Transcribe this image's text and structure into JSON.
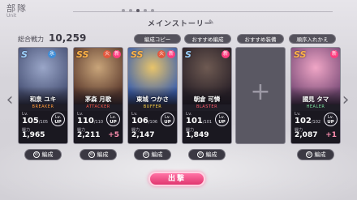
{
  "header": {
    "title": "部隊",
    "subtitle": "Unit",
    "party_name": "メインストーリー",
    "party_dots": 5,
    "active_dot": 2
  },
  "total_power": {
    "label": "総合戦力",
    "value": "10,259"
  },
  "buttons": {
    "edit_copy": "編成コピー",
    "recommend_party": "おすすめ編成",
    "recommend_equip": "おすすめ装備",
    "reorder": "順序入れかえ",
    "edit": "編成",
    "sortie": "出撃"
  },
  "lv_label": "Lv.",
  "power_label": "戦力",
  "lvup_top": "Lv.",
  "lvup_bottom": "UP",
  "members": [
    {
      "rarity": "S",
      "element": "氷",
      "element_color": "#3f8ed8",
      "new": "",
      "name": "和泉 ユキ",
      "role": "BREAKER",
      "role_color": "#ff9a3c",
      "lv": "105",
      "lv_max": "/105",
      "power": "1,965",
      "bonus": "",
      "art_a": "#9aa6c8",
      "art_b": "#4a5478"
    },
    {
      "rarity": "SS",
      "element": "火",
      "element_color": "#e2583e",
      "new": "新",
      "name": "茅森 月歌",
      "role": "ATTACKER",
      "role_color": "#ff5a4a",
      "lv": "110",
      "lv_max": "/110",
      "power": "2,211",
      "bonus": "+5",
      "art_a": "#c9a57a",
      "art_b": "#5d3b2e"
    },
    {
      "rarity": "SS",
      "element": "火",
      "element_color": "#e2583e",
      "new": "新",
      "name": "東城 つかさ",
      "role": "BUFFER",
      "role_color": "#ffd54a",
      "lv": "106",
      "lv_max": "/106",
      "power": "2,147",
      "bonus": "",
      "art_a": "#e8c46a",
      "art_b": "#3a5fae"
    },
    {
      "rarity": "S",
      "element": "",
      "element_color": "#000000",
      "new": "新",
      "name": "朝倉 可憐",
      "role": "BLASTER",
      "role_color": "#ff5a6a",
      "lv": "101",
      "lv_max": "/101",
      "power": "1,849",
      "bonus": "",
      "art_a": "#6e5a52",
      "art_b": "#2a2128"
    },
    {
      "rarity": "SS",
      "element": "",
      "element_color": "#000000",
      "new": "新",
      "name": "國見 タマ",
      "role": "HEALER",
      "role_color": "#7ee0a0",
      "lv": "102",
      "lv_max": "/102",
      "power": "2,087",
      "bonus": "+1",
      "art_a": "#f0a6c6",
      "art_b": "#7d4e7a"
    }
  ]
}
